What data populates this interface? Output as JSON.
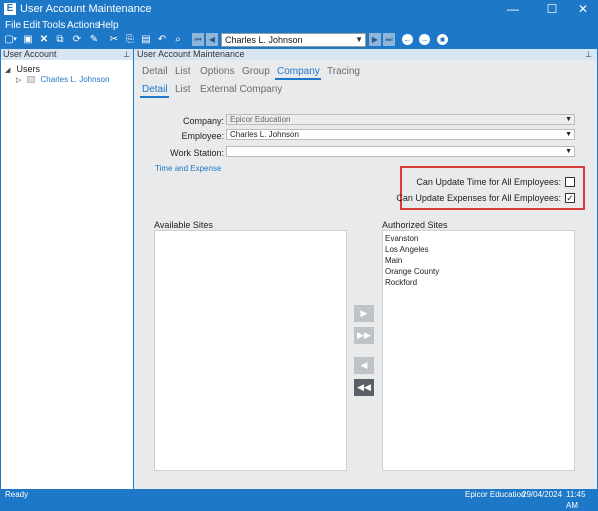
{
  "window": {
    "app_icon": "E",
    "title": "User Account Maintenance",
    "controls": {
      "minimize": "—",
      "maximize": "☐",
      "close": "✕"
    }
  },
  "menu": [
    "File",
    "Edit",
    "Tools",
    "Actions",
    "Help"
  ],
  "toolbar": {
    "record_selector_value": "Charles L. Johnson"
  },
  "left_panel": {
    "header": "User Account",
    "tree": {
      "root_label": "Users",
      "child_label": "Charles L. Johnson"
    }
  },
  "main_panel": {
    "header": "User Account Maintenance",
    "tabs": [
      "Detail",
      "List",
      "Options",
      "Group",
      "Company",
      "Tracing"
    ],
    "active_tab": "Company",
    "subtabs": [
      "Detail",
      "List",
      "External Company"
    ],
    "active_subtab": "Detail",
    "form": {
      "company_label": "Company:",
      "company_value": "Epicor Education",
      "employee_label": "Employee:",
      "employee_value": "Charles L. Johnson",
      "workstation_label": "Work Station:",
      "workstation_value": "",
      "time_expense_link": "Time and Expense",
      "can_update_time_label": "Can Update Time for All Employees:",
      "can_update_time_checked": false,
      "can_update_expenses_label": "Can Update Expenses for All Employees:",
      "can_update_expenses_checked": true
    },
    "available_sites": {
      "label": "Available Sites",
      "items": []
    },
    "authorized_sites": {
      "label": "Authorized Sites",
      "items": [
        "Evanston",
        "Los Angeles",
        "Main",
        "Orange County",
        "Rockford"
      ]
    }
  },
  "status_bar": {
    "left": "Ready",
    "company": "Epicor Education",
    "date": "29/04/2024",
    "time": "11:45 AM"
  },
  "colors": {
    "chrome_blue": "#1e78c8",
    "highlight_red": "#d93a3a",
    "link_blue": "#1e78c8"
  }
}
